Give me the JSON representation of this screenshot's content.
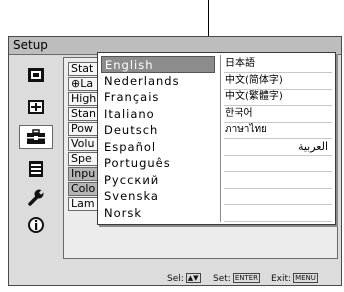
{
  "window": {
    "title": "Setup"
  },
  "sidebar": {
    "items": [
      {
        "icon": "picture-icon",
        "active": false
      },
      {
        "icon": "screen-adjust-icon",
        "active": false
      },
      {
        "icon": "toolbox-icon",
        "active": true
      },
      {
        "icon": "menu-list-icon",
        "active": false
      },
      {
        "icon": "wrench-icon",
        "active": false
      },
      {
        "icon": "info-icon",
        "active": false
      }
    ]
  },
  "main": {
    "rows": [
      {
        "label": "Stat",
        "highlight": false
      },
      {
        "label": "\u0001La",
        "highlight": false
      },
      {
        "label": "High",
        "highlight": false
      },
      {
        "label": "Stan",
        "highlight": false
      },
      {
        "label": "Pow",
        "highlight": false
      },
      {
        "label": "Volu",
        "highlight": false
      },
      {
        "label": "Spe",
        "highlight": false
      },
      {
        "label": "Inpu",
        "highlight": true
      },
      {
        "label": "Colo",
        "highlight": true
      },
      {
        "label": "Lam",
        "highlight": false
      }
    ]
  },
  "language_menu": {
    "left": [
      {
        "label": "English",
        "selected": true
      },
      {
        "label": "Nederlands",
        "selected": false
      },
      {
        "label": "Français",
        "selected": false
      },
      {
        "label": "Italiano",
        "selected": false
      },
      {
        "label": "Deutsch",
        "selected": false
      },
      {
        "label": "Español",
        "selected": false
      },
      {
        "label": "Português",
        "selected": false
      },
      {
        "label": "Русский",
        "selected": false
      },
      {
        "label": "Svenska",
        "selected": false
      },
      {
        "label": "Norsk",
        "selected": false
      }
    ],
    "right": [
      {
        "label": "日本語"
      },
      {
        "label": "中文(简体字)"
      },
      {
        "label": "中文(繁體字)"
      },
      {
        "label": "한국어"
      },
      {
        "label": "ภาษาไทย"
      },
      {
        "label": "العربية",
        "rtl": true
      },
      {
        "label": ""
      },
      {
        "label": ""
      },
      {
        "label": ""
      },
      {
        "label": ""
      }
    ]
  },
  "status_bar": {
    "sel_label": "Sel:",
    "set_label": "Set:",
    "set_key": "ENTER",
    "exit_label": "Exit:",
    "exit_key": "MENU"
  }
}
